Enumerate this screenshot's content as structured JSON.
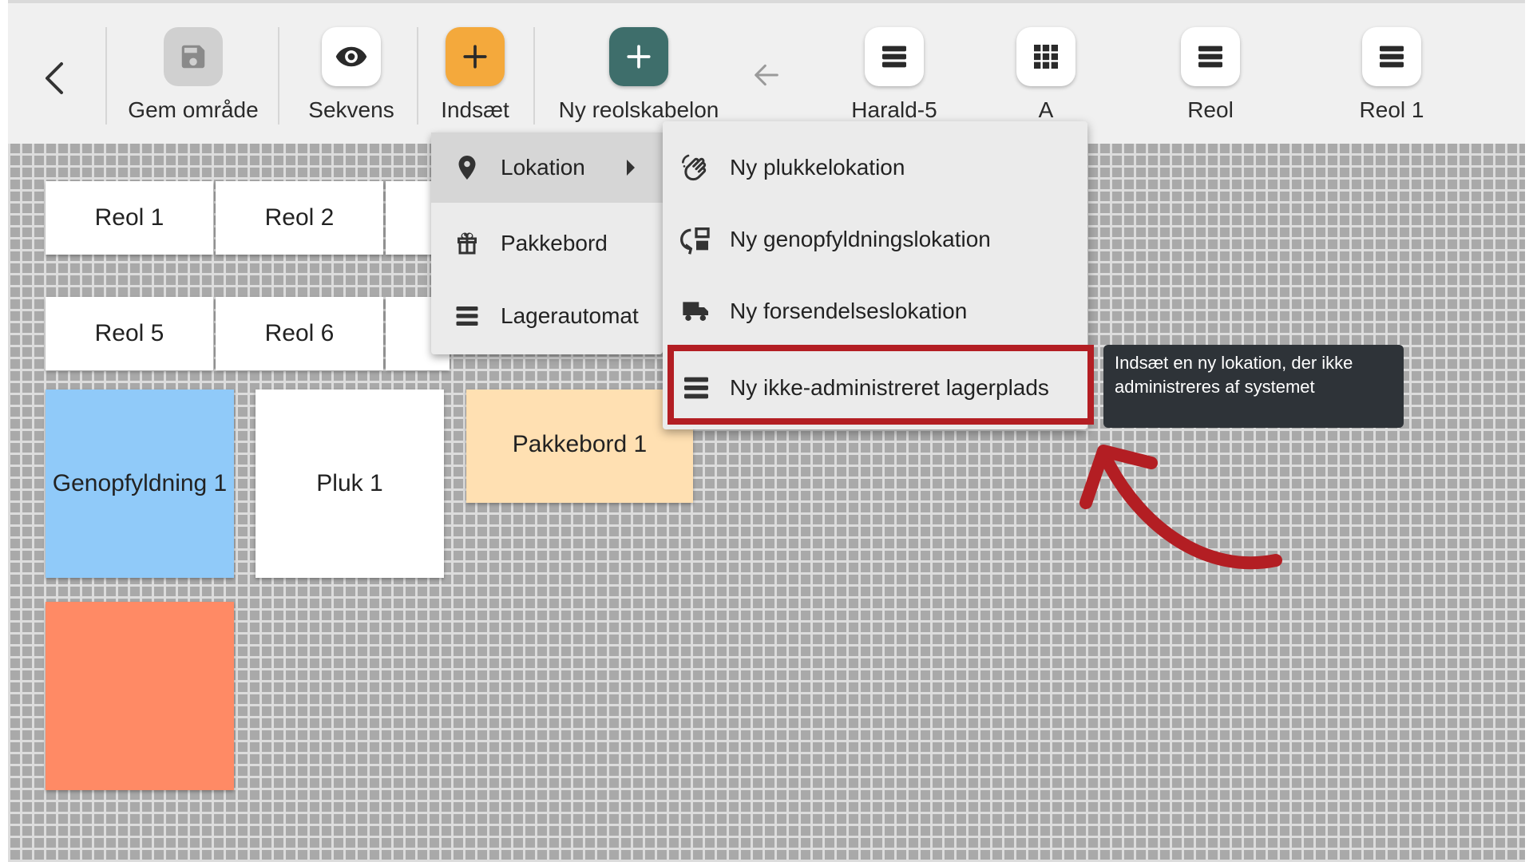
{
  "toolbar": {
    "back_label": "",
    "items": [
      {
        "label": "Gem område",
        "icon": "save-icon",
        "color": "#d0d0d0"
      },
      {
        "label": "Sekvens",
        "icon": "eye-icon",
        "color": "#ffffff"
      },
      {
        "label": "Indsæt",
        "icon": "plus-icon",
        "color": "#f4a93c"
      },
      {
        "label": "Ny reolskabelon",
        "icon": "plus-icon",
        "color": "#3e6e6b"
      },
      {
        "label": "Harald-5",
        "icon": "list-icon",
        "color": "#ffffff"
      },
      {
        "label": "A",
        "icon": "grid-icon",
        "color": "#ffffff"
      },
      {
        "label": "Reol",
        "icon": "list-icon",
        "color": "#ffffff"
      },
      {
        "label": "Reol 1",
        "icon": "list-icon",
        "color": "#ffffff"
      }
    ]
  },
  "canvas": {
    "tiles": [
      "Reol 1",
      "Reol 2",
      "Reol 5",
      "Reol 6",
      "Genopfyldning 1",
      "Pluk 1",
      "Pakkebord 1"
    ]
  },
  "insert_menu": {
    "items": [
      {
        "label": "Lokation",
        "icon": "location-pin-icon",
        "has_submenu": true
      },
      {
        "label": "Pakkebord",
        "icon": "gift-icon"
      },
      {
        "label": "Lagerautomat",
        "icon": "list-icon"
      }
    ]
  },
  "location_submenu": {
    "items": [
      {
        "label": "Ny plukkelokation",
        "icon": "hand-wave-icon"
      },
      {
        "label": "Ny genopfyldningslokation",
        "icon": "refill-icon"
      },
      {
        "label": "Ny forsendelseslokation",
        "icon": "truck-icon"
      },
      {
        "label": "Ny ikke-administreret lagerplads",
        "icon": "list-icon"
      }
    ]
  },
  "tooltip": {
    "text": "Indsæt en ny lokation, der ikke administreres af systemet"
  },
  "colors": {
    "highlight": "#b31e23",
    "replenish_tile": "#90caf9",
    "packing_tile": "#ffe0b2",
    "orange_tile": "#ff8a65"
  }
}
